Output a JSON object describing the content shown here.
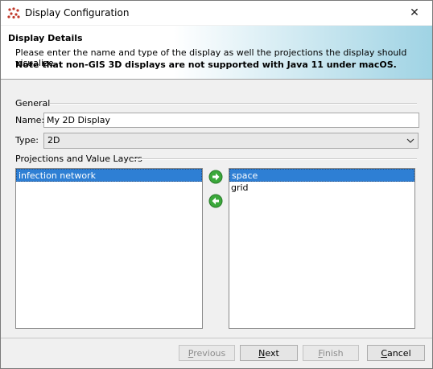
{
  "window": {
    "title": "Display Configuration",
    "close_glyph": "✕"
  },
  "header": {
    "title": "Display Details",
    "description": "Please enter the name and type of the display as well the projections the display should visualize.",
    "note": "Note that non-GIS 3D displays are not supported with Java 11 under macOS."
  },
  "general": {
    "label": "General",
    "name_label": "Name:",
    "name_value": "My 2D Display",
    "type_label": "Type:",
    "type_value": "2D"
  },
  "projections": {
    "label": "Projections and Value Layers",
    "available": [
      {
        "label": "infection network",
        "selected": true
      }
    ],
    "chosen": [
      {
        "label": "space",
        "selected": true
      },
      {
        "label": "grid",
        "selected": false
      }
    ]
  },
  "icons": {
    "add": "right-arrow-icon",
    "remove": "left-arrow-icon",
    "accent": "#3aa83a"
  },
  "footer": {
    "previous_prefix": "",
    "previous_mnemonic": "P",
    "previous_rest": "revious",
    "next_prefix": "",
    "next_mnemonic": "N",
    "next_rest": "ext",
    "finish_prefix": "",
    "finish_mnemonic": "F",
    "finish_rest": "inish",
    "cancel_prefix": "",
    "cancel_mnemonic": "C",
    "cancel_rest": "ancel"
  }
}
